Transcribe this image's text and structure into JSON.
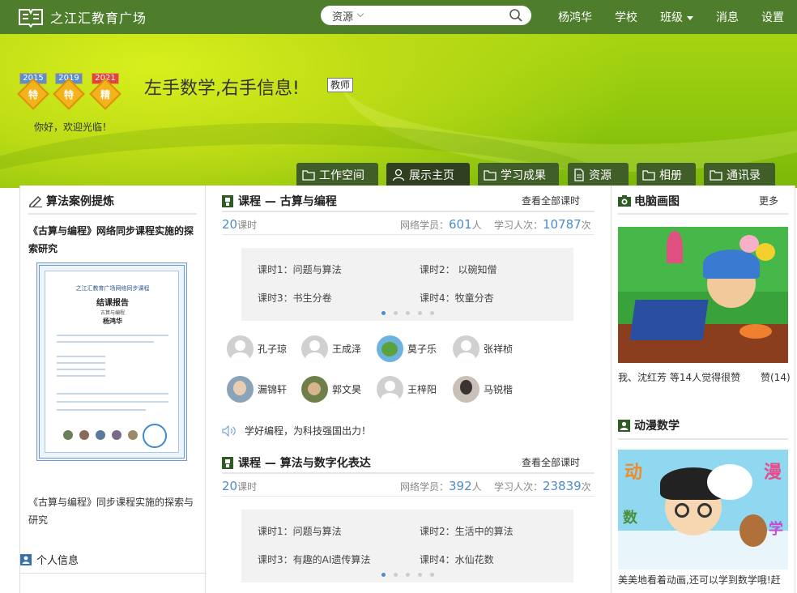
{
  "header": {
    "site_title": "之江汇教育广场",
    "search_type": "资源",
    "search_placeholder": "",
    "nav": [
      "杨鸿华",
      "学校",
      "班级",
      "消息",
      "设置"
    ]
  },
  "banner": {
    "badges": [
      {
        "year": "2015",
        "grade": "特"
      },
      {
        "year": "2019",
        "grade": "特"
      },
      {
        "year": "2021",
        "grade": "精"
      }
    ],
    "welcome": "你好，欢迎光临！",
    "motto": "左手数学,右手信息!",
    "role": "教师",
    "tabs": [
      "工作空间",
      "展示主页",
      "学习成果",
      "资源",
      "相册",
      "通讯录"
    ],
    "active_tab": "展示主页"
  },
  "left": {
    "title": "算法案例提炼",
    "article_title": "《古算与编程》网络同步课程实施的探索研究",
    "certificate": {
      "title": "之江汇教育广场网络同步课程",
      "heading": "结课报告",
      "subtitle": "古算与编程",
      "name": "杨鸿华"
    },
    "caption": "《古算与编程》同步课程实施的探索与研究",
    "info_title": "个人信息"
  },
  "courses": [
    {
      "title": "课程 — 古算与编程",
      "view_all": "查看全部课时",
      "hours": "20",
      "hours_unit": "课时",
      "members_label": "网络学员：",
      "members": "601",
      "members_unit": "人",
      "visits_label": "学习人次：",
      "visits": "10787",
      "visits_unit": "次",
      "lessons": [
        "课时1：问题与算法",
        "课时2： 以碗知僧",
        "课时3：书生分卷",
        "课时4：牧童分杏"
      ],
      "students": [
        "孔子琼",
        "王成泽",
        "莫子乐",
        "张祥桢",
        "漏锦轩",
        "郭文昊",
        "王梓阳",
        "马锐楷"
      ],
      "notice": "学好编程，为科技强国出力！"
    },
    {
      "title": "课程 — 算法与数字化表达",
      "view_all": "查看全部课时",
      "hours": "20",
      "hours_unit": "课时",
      "members_label": "网络学员：",
      "members": "392",
      "members_unit": "人",
      "visits_label": "学习人次：",
      "visits": "23839",
      "visits_unit": "次",
      "lessons": [
        "课时1：问题与算法",
        "课时2：生活中的算法",
        "课时3：有趣的AI遗传算法",
        "课时4：水仙花数"
      ]
    }
  ],
  "right": {
    "gallery_title": "电脑画图",
    "more": "更多",
    "likes_text": "我、沈红芳  等14人觉得很赞",
    "like_label": "赞(14)",
    "comic_title": "动漫数学",
    "comic_caption": "美美地看着动画,还可以学到数学哦!赶"
  },
  "colors": {
    "topbar": "#4e7d2c",
    "tab": "#3f5e28",
    "link_blue": "#4f8cc9"
  }
}
